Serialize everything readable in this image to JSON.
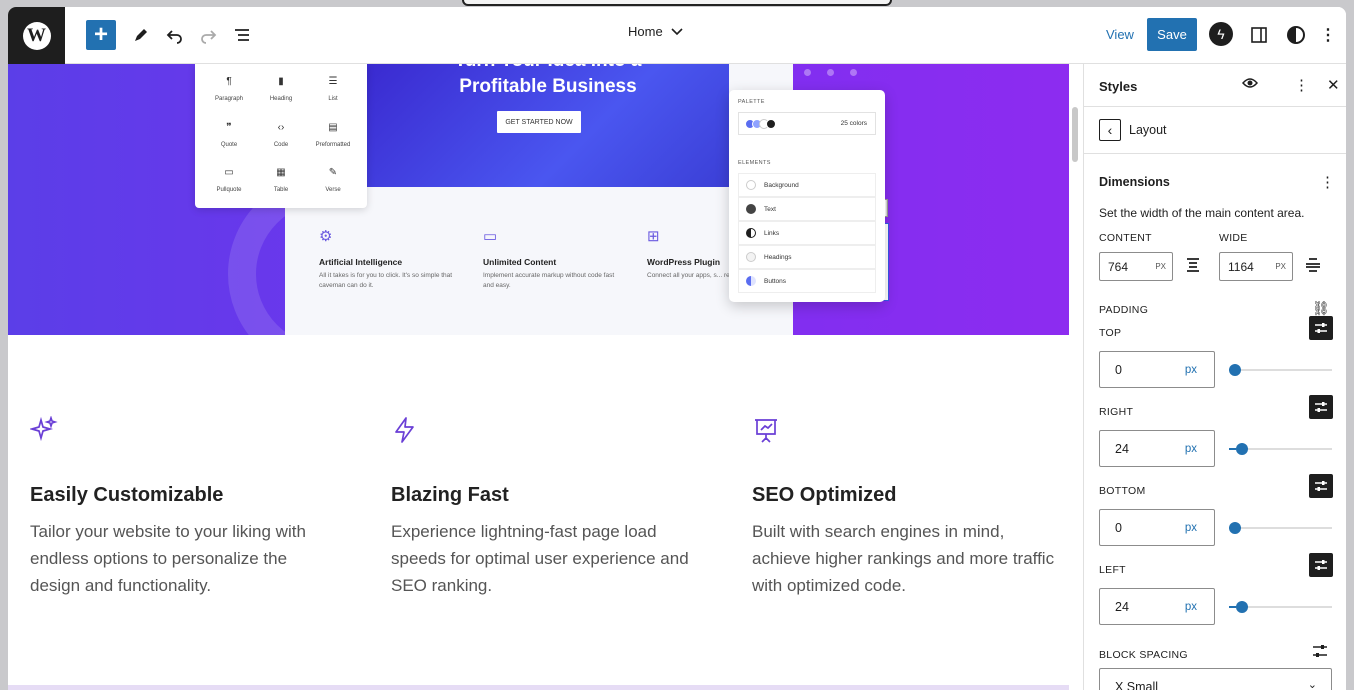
{
  "topbar": {
    "logo": "W",
    "add_icon": "+",
    "document_title": "Home",
    "view_label": "View",
    "save_label": "Save"
  },
  "canvas": {
    "hero": {
      "headline_top": "Turn Your Idea into a",
      "headline": "Profitable Business",
      "cta": "GET STARTED NOW"
    },
    "inserter": {
      "items": [
        {
          "icon": "¶",
          "label": "Paragraph"
        },
        {
          "icon": "▮",
          "label": "Heading"
        },
        {
          "icon": "☰",
          "label": "List"
        },
        {
          "icon": "❞",
          "label": "Quote"
        },
        {
          "icon": "‹›",
          "label": "Code"
        },
        {
          "icon": "▤",
          "label": "Preformatted"
        },
        {
          "icon": "▭",
          "label": "Pullquote"
        },
        {
          "icon": "▦",
          "label": "Table"
        },
        {
          "icon": "✎",
          "label": "Verse"
        }
      ]
    },
    "cards": [
      {
        "title": "Artificial Intelligence",
        "text": "All it takes is for you to click. It's so simple that caveman can do it."
      },
      {
        "title": "Unlimited Content",
        "text": "Implement accurate markup without code fast and easy."
      },
      {
        "title": "WordPress Plugin",
        "text": "Connect all your apps, s... repetitive tasks."
      }
    ],
    "palette_panel": {
      "palette_heading": "PALETTE",
      "colors_count": "25 colors",
      "elements_heading": "ELEMENTS",
      "elements": [
        "Background",
        "Text",
        "Links",
        "Headings",
        "Buttons"
      ]
    },
    "features": [
      {
        "title": "Easily Customizable",
        "text": "Tailor your website to your liking with endless options to personalize the design and functionality."
      },
      {
        "title": "Blazing Fast",
        "text": "Experience lightning-fast page load speeds for optimal user experience and SEO ranking."
      },
      {
        "title": "SEO Optimized",
        "text": "Built with search engines in mind, achieve higher rankings and more traffic with optimized code."
      }
    ]
  },
  "sidebar": {
    "title": "Styles",
    "nav_label": "Layout",
    "section_title": "Dimensions",
    "section_desc": "Set the width of the main content area.",
    "content_label": "CONTENT",
    "content_value": "764",
    "wide_label": "WIDE",
    "wide_value": "1164",
    "small_unit": "PX",
    "padding_label": "PADDING",
    "padding": [
      {
        "label": "TOP",
        "value": "0",
        "unit": "px",
        "fraction": 0.0
      },
      {
        "label": "RIGHT",
        "value": "24",
        "unit": "px",
        "fraction": 0.07
      },
      {
        "label": "BOTTOM",
        "value": "0",
        "unit": "px",
        "fraction": 0.0
      },
      {
        "label": "LEFT",
        "value": "24",
        "unit": "px",
        "fraction": 0.07
      }
    ],
    "block_spacing_label": "BLOCK SPACING",
    "block_spacing_value": "X Small"
  },
  "colors": {
    "accent": "#2271b1",
    "hero_purple": "#7b2ff0",
    "feature_icon": "#6a3fd6"
  }
}
